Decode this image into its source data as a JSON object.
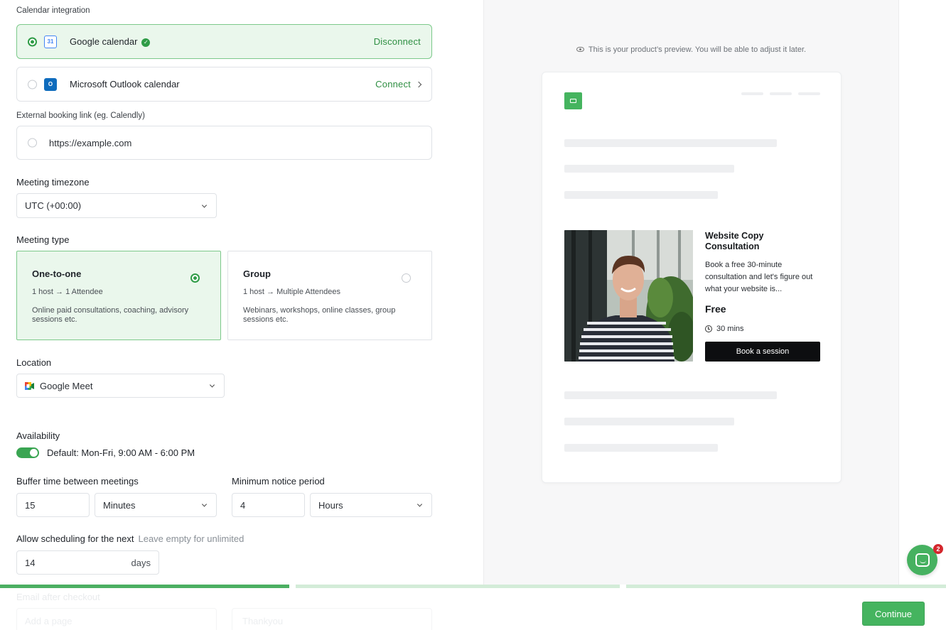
{
  "calendar": {
    "section_label": "Calendar integration",
    "google": {
      "name": "Google calendar",
      "action": "Disconnect",
      "logo_text": "31"
    },
    "outlook": {
      "name": "Microsoft Outlook calendar",
      "action": "Connect"
    },
    "external_label": "External booking link (eg. Calendly)",
    "external_value": "https://example.com"
  },
  "timezone": {
    "label": "Meeting timezone",
    "value": "UTC (+00:00)"
  },
  "meeting_type": {
    "label": "Meeting type",
    "options": [
      {
        "title": "One-to-one",
        "sub": "1 host → 1 Attendee",
        "desc": "Online paid consultations, coaching, advisory sessions etc.",
        "selected": true
      },
      {
        "title": "Group",
        "sub": "1 host → Multiple Attendees",
        "desc": "Webinars, workshops, online classes, group sessions etc.",
        "selected": false
      }
    ]
  },
  "location": {
    "label": "Location",
    "value": "Google Meet"
  },
  "availability": {
    "label": "Availability",
    "value": "Default: Mon-Fri, 9:00 AM - 6:00 PM",
    "enabled": true
  },
  "buffer": {
    "label": "Buffer time between meetings",
    "value": "15",
    "unit": "Minutes"
  },
  "notice": {
    "label": "Minimum notice period",
    "value": "4",
    "unit": "Hours"
  },
  "scheduling": {
    "label": "Allow scheduling for the next",
    "hint": "Leave empty for unlimited",
    "value": "14",
    "unit": "days"
  },
  "hidden_next": {
    "label": "Email after checkout",
    "value1": "Add a page",
    "value2": "Thankyou"
  },
  "footer": {
    "continue_label": "Continue"
  },
  "progress": {
    "segments": 3,
    "current": 1
  },
  "preview": {
    "note": "This is your product’s preview. You will be able to adjust it later.",
    "product_title": "Website Copy Consultation",
    "product_desc": "Book a free 30-minute consultation and let's figure out what your website is...",
    "price": "Free",
    "duration": "30 mins",
    "cta": "Book a session"
  },
  "chat": {
    "badge": "2"
  },
  "colors": {
    "accent": "#45b45f",
    "accent_light": "#eaf7ec",
    "accent_text": "#2f8f43",
    "badge": "#d4272d"
  }
}
